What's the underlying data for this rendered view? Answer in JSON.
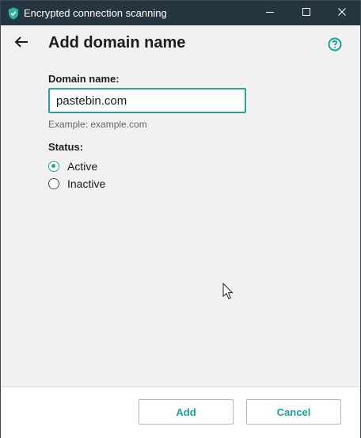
{
  "window": {
    "title": "Encrypted connection scanning",
    "icons": [
      "kaspersky-shield-icon",
      "minimize-icon",
      "maximize-icon",
      "close-icon"
    ]
  },
  "page": {
    "heading": "Add domain name",
    "back_icon": "arrow-left-icon",
    "help_icon": "question-circle-icon"
  },
  "form": {
    "domain_label": "Domain name:",
    "domain_value": "pastebin.com",
    "domain_hint": "Example: example.com",
    "status_label": "Status:",
    "status_options": [
      {
        "label": "Active",
        "selected": true
      },
      {
        "label": "Inactive",
        "selected": false
      }
    ]
  },
  "footer": {
    "add_label": "Add",
    "cancel_label": "Cancel"
  },
  "colors": {
    "titlebar": "#263640",
    "accent": "#26a69a",
    "button_text": "#15a393"
  }
}
